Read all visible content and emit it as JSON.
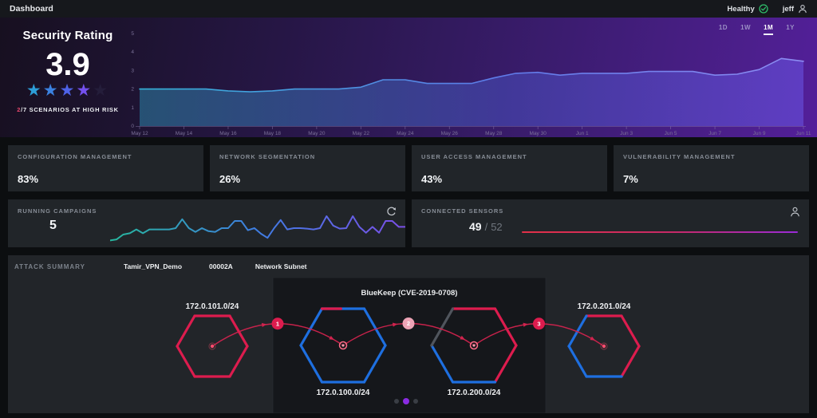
{
  "topbar": {
    "title": "Dashboard",
    "status_label": "Healthy",
    "user_name": "jeff"
  },
  "security": {
    "title": "Security Rating",
    "score": "3.9",
    "stars_filled": 4,
    "stars_total": 5,
    "risk_numerator": "2",
    "risk_text": "/7 SCENARIOS AT HIGH RISK"
  },
  "timeframes": {
    "options": [
      "1D",
      "1W",
      "1M",
      "1Y"
    ],
    "active": "1M"
  },
  "chart_data": [
    {
      "name": "security-rating-trend",
      "type": "area",
      "title": "",
      "x": [
        "May 12",
        "May 13",
        "May 14",
        "May 15",
        "May 16",
        "May 17",
        "May 18",
        "May 19",
        "May 20",
        "May 21",
        "May 22",
        "May 23",
        "May 24",
        "May 25",
        "May 26",
        "May 27",
        "May 28",
        "May 29",
        "May 30",
        "May 31",
        "Jun 1",
        "Jun 2",
        "Jun 3",
        "Jun 4",
        "Jun 5",
        "Jun 6",
        "Jun 7",
        "Jun 8",
        "Jun 9",
        "Jun 10",
        "Jun 11"
      ],
      "x_ticks": [
        "May 12",
        "May 14",
        "May 16",
        "May 18",
        "May 20",
        "May 22",
        "May 24",
        "May 26",
        "May 28",
        "May 30",
        "Jun 1",
        "Jun 3",
        "Jun 5",
        "Jun 7",
        "Jun 9",
        "Jun 11"
      ],
      "values": [
        2.0,
        2.0,
        2.0,
        2.0,
        1.9,
        1.85,
        1.9,
        2.0,
        2.0,
        2.0,
        2.1,
        2.5,
        2.5,
        2.3,
        2.3,
        2.3,
        2.6,
        2.85,
        2.9,
        2.75,
        2.85,
        2.85,
        2.85,
        2.95,
        2.95,
        2.95,
        2.75,
        2.8,
        3.05,
        3.65,
        3.5
      ],
      "ylim": [
        0,
        5
      ],
      "yticks": [
        0,
        1,
        2,
        3,
        4,
        5
      ],
      "grid": false,
      "legend": false
    },
    {
      "name": "running-campaigns-sparkline",
      "type": "line",
      "values": [
        0.02,
        0.06,
        0.25,
        0.3,
        0.45,
        0.3,
        0.45,
        0.45,
        0.45,
        0.45,
        0.5,
        0.85,
        0.5,
        0.35,
        0.5,
        0.38,
        0.35,
        0.5,
        0.5,
        0.78,
        0.78,
        0.42,
        0.5,
        0.28,
        0.12,
        0.5,
        0.82,
        0.45,
        0.5,
        0.5,
        0.48,
        0.45,
        0.5,
        0.97,
        0.6,
        0.48,
        0.5,
        0.97,
        0.55,
        0.32,
        0.55,
        0.32,
        0.78,
        0.78,
        0.55,
        0.55
      ],
      "ylim": [
        0,
        1
      ]
    }
  ],
  "metrics": [
    {
      "label": "CONFIGURATION MANAGEMENT",
      "value": "83%"
    },
    {
      "label": "NETWORK SEGMENTATION",
      "value": "26%"
    },
    {
      "label": "USER ACCESS MANAGEMENT",
      "value": "43%"
    },
    {
      "label": "VULNERABILITY MANAGEMENT",
      "value": "7%"
    }
  ],
  "campaigns": {
    "label": "RUNNING CAMPAIGNS",
    "count": "5"
  },
  "sensors": {
    "label": "CONNECTED SENSORS",
    "connected": "49",
    "separator": "/",
    "total": "52"
  },
  "attack": {
    "label": "ATTACK SUMMARY",
    "campaign_name": "Tamir_VPN_Demo",
    "campaign_id": "00002A",
    "scenario_type": "Network Subnet",
    "exploit_title": "BlueKeep (CVE-2019-0708)",
    "nodes": [
      {
        "label": "172.0.101.0/24",
        "label_pos": "top",
        "marker": "dot",
        "edges": [
          "red",
          "red",
          "red",
          "red",
          "red",
          "red"
        ]
      },
      {
        "label": "172.0.100.0/24",
        "label_pos": "bottom",
        "marker": "ring",
        "edges": [
          "blue",
          "blue",
          "blue",
          "blue",
          "blue",
          "blue"
        ],
        "top_accent": "red"
      },
      {
        "label": "172.0.200.0/24",
        "label_pos": "bottom",
        "marker": "ring",
        "edges": [
          "red",
          "red",
          "red",
          "blue",
          "blue",
          "gray"
        ]
      },
      {
        "label": "172.0.201.0/24",
        "label_pos": "top",
        "marker": "dot",
        "edges": [
          "red",
          "red",
          "red",
          "blue",
          "blue",
          "blue"
        ]
      }
    ],
    "steps": [
      "1",
      "2",
      "3"
    ],
    "pagination": {
      "count": 3,
      "active": 1
    }
  },
  "colors": {
    "healthy": "#2fbf6b",
    "risk": "#e8496d",
    "red": "#dd1c4e",
    "blue": "#1e6fe0",
    "gray": "#50555d",
    "arrow": "#d2234e",
    "active_dot": "#8a2be2",
    "line_start": "#35b2d8",
    "line_end": "#8d8cf2"
  }
}
